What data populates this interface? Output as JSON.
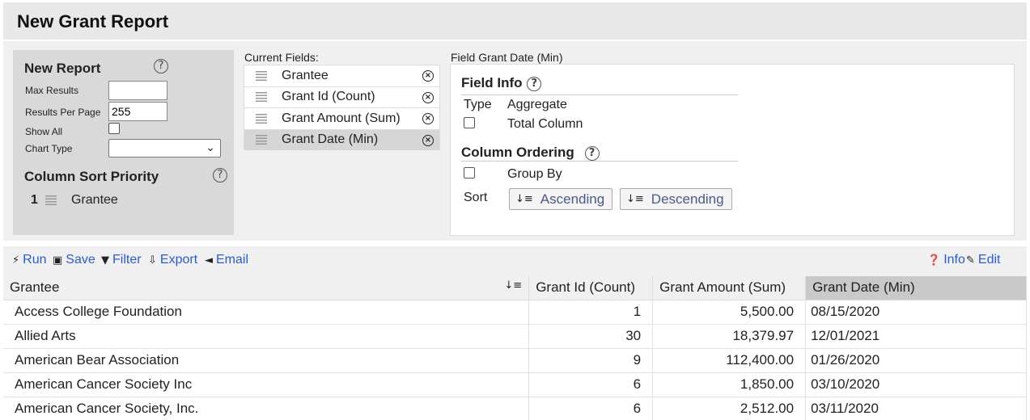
{
  "title": "New Grant Report",
  "new_report": {
    "header": "New Report",
    "max_results_label": "Max Results",
    "max_results_value": "",
    "results_per_page_label": "Results Per Page",
    "results_per_page_value": "255",
    "show_all_label": "Show All",
    "chart_type_label": "Chart Type",
    "chart_type_value": "",
    "column_sort_priority_header": "Column Sort Priority",
    "sort_priority": [
      {
        "rank": "1",
        "field": "Grantee"
      }
    ]
  },
  "current_fields": {
    "label": "Current Fields:",
    "items": [
      {
        "label": "Grantee"
      },
      {
        "label": "Grant Id (Count)"
      },
      {
        "label": "Grant Amount (Sum)"
      },
      {
        "label": "Grant Date (Min)"
      }
    ]
  },
  "field_detail": {
    "label": "Field Grant Date (Min)",
    "field_info_header": "Field Info",
    "type_label": "Type",
    "type_value": "Aggregate",
    "total_column_label": "Total Column",
    "column_ordering_header": "Column Ordering",
    "group_by_label": "Group By",
    "sort_label": "Sort",
    "ascending_label": "Ascending",
    "descending_label": "Descending"
  },
  "toolbar": {
    "run": "Run",
    "save": "Save",
    "filter": "Filter",
    "export": "Export",
    "email": "Email",
    "info": "Info",
    "edit": "Edit"
  },
  "table": {
    "columns": [
      "Grantee",
      "Grant Id (Count)",
      "Grant Amount (Sum)",
      "Grant Date (Min)"
    ],
    "rows": [
      [
        "Access College Foundation",
        "1",
        "5,500.00",
        "08/15/2020"
      ],
      [
        "Allied Arts",
        "30",
        "18,379.97",
        "12/01/2021"
      ],
      [
        "American Bear Association",
        "9",
        "112,400.00",
        "01/26/2020"
      ],
      [
        "American Cancer Society Inc",
        "6",
        "1,850.00",
        "03/10/2020"
      ],
      [
        "American Cancer Society, Inc.",
        "6",
        "2,512.00",
        "03/11/2020"
      ]
    ]
  },
  "icons": {
    "help": "question-circle-icon",
    "remove": "remove-circle-icon",
    "drag": "drag-handle-icon"
  },
  "colors": {
    "link": "#2a5bd7",
    "panel": "#f0f0f0",
    "selected_header": "#c9c9c9"
  }
}
